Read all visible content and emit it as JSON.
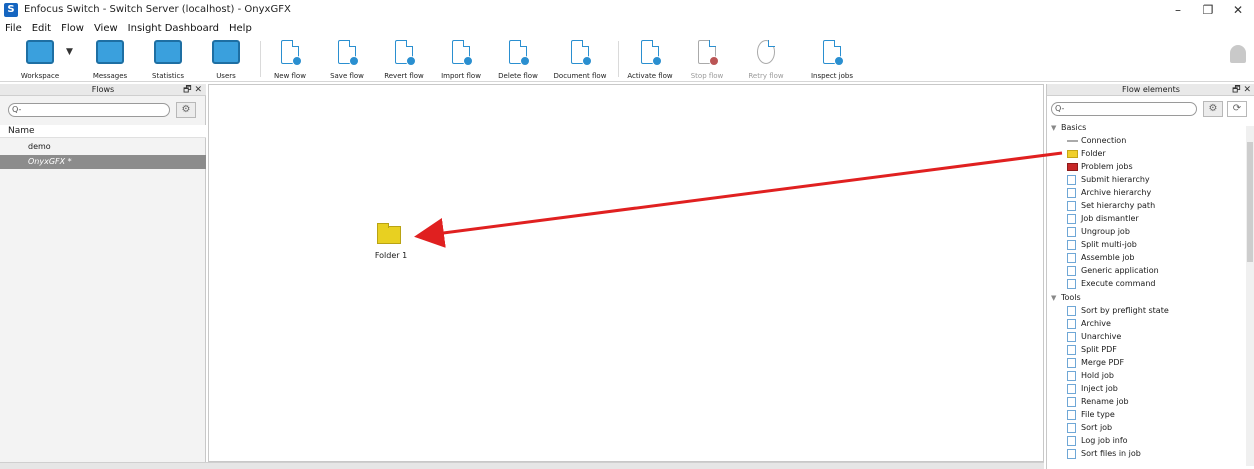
{
  "window": {
    "title": "Enfocus Switch - Switch Server (localhost) - OnyxGFX",
    "app_icon_letter": "S",
    "minimize": "–",
    "restore": "❐",
    "close": "✕"
  },
  "menu": [
    "File",
    "Edit",
    "Flow",
    "View",
    "Insight Dashboard",
    "Help"
  ],
  "toolbar": {
    "workspace": "Workspace",
    "messages": "Messages",
    "statistics": "Statistics",
    "users": "Users",
    "new_flow": "New flow",
    "save_flow": "Save flow",
    "revert_flow": "Revert flow",
    "import_flow": "Import flow",
    "delete_flow": "Delete flow",
    "document_flow": "Document flow",
    "activate_flow": "Activate flow",
    "stop_flow": "Stop flow",
    "retry_flow": "Retry flow",
    "inspect_jobs": "Inspect jobs"
  },
  "flows_panel": {
    "title": "Flows",
    "controls": "🗗 ✕",
    "search_placeholder": "Q-",
    "column_header": "Name",
    "items": [
      "demo",
      "OnyxGFX *"
    ]
  },
  "canvas": {
    "folder_label": "Folder 1"
  },
  "elements_panel": {
    "title": "Flow elements",
    "controls": "🗗 ✕",
    "search_placeholder": "Q-",
    "sections": [
      {
        "name": "Basics",
        "items": [
          "Connection",
          "Folder",
          "Problem jobs",
          "Submit hierarchy",
          "Archive hierarchy",
          "Set hierarchy path",
          "Job dismantler",
          "Ungroup job",
          "Split multi-job",
          "Assemble job",
          "Generic application",
          "Execute command"
        ]
      },
      {
        "name": "Tools",
        "items": [
          "Sort by preflight state",
          "Archive",
          "Unarchive",
          "Split PDF",
          "Merge PDF",
          "Hold job",
          "Inject job",
          "Rename job",
          "File type",
          "Sort job",
          "Log job info",
          "Sort files in job"
        ]
      }
    ]
  },
  "colors": {
    "accent": "#2a8fd0",
    "folder": "#e8d021",
    "arrow": "#e02020",
    "selected_row": "#8c8c8c"
  }
}
